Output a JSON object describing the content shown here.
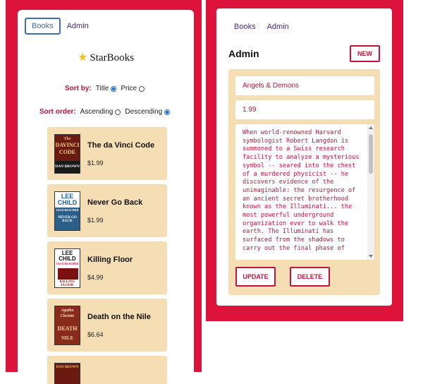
{
  "left": {
    "nav": {
      "books": "Books",
      "admin": "Admin"
    },
    "brand": {
      "icon": "star-icon",
      "name": "StarBooks"
    },
    "sort_by": {
      "label": "Sort by:",
      "title": "Title",
      "price": "Price",
      "selected": "Title"
    },
    "sort_order": {
      "label": "Sort order:",
      "ascending": "Ascending",
      "descending": "Descending",
      "selected": "Descending"
    },
    "books": [
      {
        "title": "The da Vinci Code",
        "price": "$1.99",
        "cover": {
          "line1": "The",
          "line2": "DAVINCI",
          "line3": "CODE",
          "author": "DAN BROWN"
        }
      },
      {
        "title": "Never Go Back",
        "price": "$1.99",
        "cover": {
          "line1": "LEE",
          "line2": "CHILD",
          "line3": "JACK REACHER",
          "author": "NEVER GO BACK"
        }
      },
      {
        "title": "Killing Floor",
        "price": "$4.99",
        "cover": {
          "line1": "LEE",
          "line2": "CHILD",
          "line3": "JACK REACHER",
          "author": "KILLING FLOOR"
        }
      },
      {
        "title": "Death on the Nile",
        "price": "$6.64",
        "cover": {
          "line1": "Agatha",
          "line2": "Christie",
          "line3": "DEATH",
          "author": "NILE"
        }
      },
      {
        "title": "",
        "price": "",
        "cover": {
          "line1": "DAN BROWN",
          "line2": "",
          "line3": "",
          "author": ""
        }
      }
    ]
  },
  "right": {
    "nav": {
      "books": "Books",
      "admin": "Admin"
    },
    "title": "Admin",
    "new_button": "NEW",
    "form": {
      "title_value": "Angels & Demons",
      "price_value": "1.99",
      "description": "When world-renowned Harvard symbologist Robert Langdon is summoned to a Swiss research facility to analyze a mysterious symbol -- seared into the chest of a murdered physicist -- he discovers evidence of the unimaginable: the resurgence of an ancient secret brotherhood known as the Illuminati... the most powerful underground organization ever to walk the earth. The Illuminati has surfaced from the shadows to carry out the final phase of"
    },
    "update_button": "UPDATE",
    "delete_button": "DELETE"
  },
  "colors": {
    "frame": "#dc143c",
    "card_bg": "#f5deb3",
    "accent": "#c4123a",
    "nav_link": "#4b2a86",
    "active_border": "#3f6db1"
  }
}
